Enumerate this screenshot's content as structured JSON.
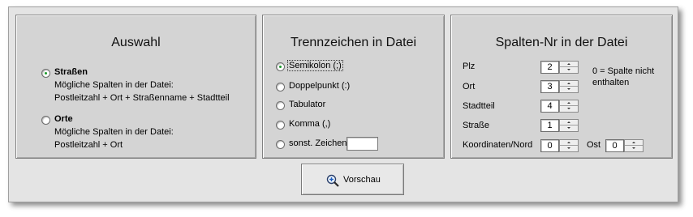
{
  "auswahl": {
    "title": "Auswahl",
    "options": [
      {
        "label": "Straßen",
        "desc1": "Mögliche Spalten in der Datei:",
        "desc2": "Postleitzahl + Ort + Straßenname + Stadtteil",
        "checked": true
      },
      {
        "label": "Orte",
        "desc1": "Mögliche Spalten in der Datei:",
        "desc2": "Postleitzahl + Ort",
        "checked": false
      }
    ]
  },
  "trennzeichen": {
    "title": "Trennzeichen in Datei",
    "options": [
      {
        "label": "Semikolon (;)",
        "checked": true
      },
      {
        "label": "Doppelpunkt (:)",
        "checked": false
      },
      {
        "label": "Tabulator",
        "checked": false
      },
      {
        "label": "Komma (,)",
        "checked": false
      },
      {
        "label": "sonst. Zeichen",
        "checked": false
      }
    ],
    "other_value": ""
  },
  "spalten": {
    "title": "Spalten-Nr in der Datei",
    "fields": [
      {
        "label": "Plz",
        "value": "2"
      },
      {
        "label": "Ort",
        "value": "3"
      },
      {
        "label": "Stadtteil",
        "value": "4"
      },
      {
        "label": "Straße",
        "value": "1"
      }
    ],
    "coord_nord": {
      "label": "Koordinaten/Nord",
      "value": "0"
    },
    "coord_ost": {
      "label": "Ost",
      "value": "0"
    },
    "note_line1": "0 = Spalte nicht",
    "note_line2": "enthalten"
  },
  "preview_button": {
    "label": "Vorschau",
    "icon": "magnifier-plus-icon"
  }
}
